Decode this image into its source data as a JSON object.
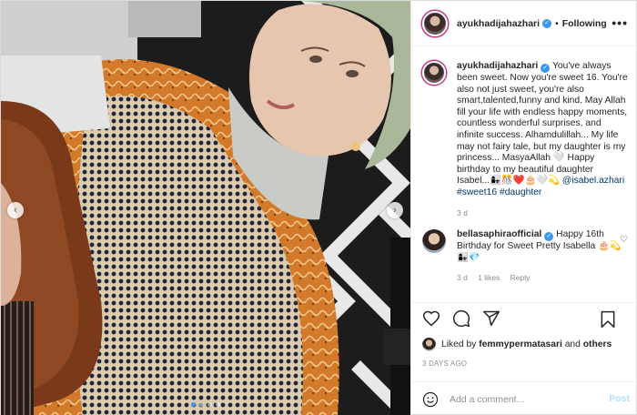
{
  "post": {
    "username": "ayukhadijahazhari",
    "follow_state": "Following",
    "caption_body": "You've always been sweet. Now you're sweet 16. You're also not just sweet, you're also smart,talented,funny and kind. May Allah fill your life with endless happy moments, countless wonderful surprises, and infinite success. Alhamdulillah... My life may not fairy tale, but my daughter is my princess... MasyaAllah 🤍 Happy birthday to my beautiful daughter Isabel...👩‍👧🎊❤️🎂🤍💫",
    "caption_mention": "@isabel.azhari",
    "caption_tag1": "#sweet16",
    "caption_tag2": "#daughter",
    "caption_age": "3 d"
  },
  "comment": {
    "username": "bellasaphiraofficial",
    "text": "Happy 16th Birthday for Sweet Pretty Isabella 🎂💫👩‍👧💎",
    "age": "3 d",
    "likes": "1 likes",
    "reply": "Reply"
  },
  "liked_by": {
    "prefix": "Liked by",
    "user": "femmypermatasari",
    "conj": "and",
    "others": "others"
  },
  "date_label": "3 DAYS AGO",
  "add_comment": {
    "placeholder": "Add a comment...",
    "post_label": "Post"
  },
  "icons": {
    "like": "heart-icon",
    "comment": "comment-icon",
    "share": "share-icon",
    "save": "bookmark-icon",
    "options": "more-options-icon",
    "emoji": "emoji-icon",
    "verified": "verified-badge-icon"
  },
  "colors": {
    "link": "#00376b",
    "muted": "#8e8e8e",
    "verified": "#3897f0",
    "post_disabled": "#b2dffc"
  },
  "carousel": {
    "slide_count": 4,
    "active_index": 0
  }
}
